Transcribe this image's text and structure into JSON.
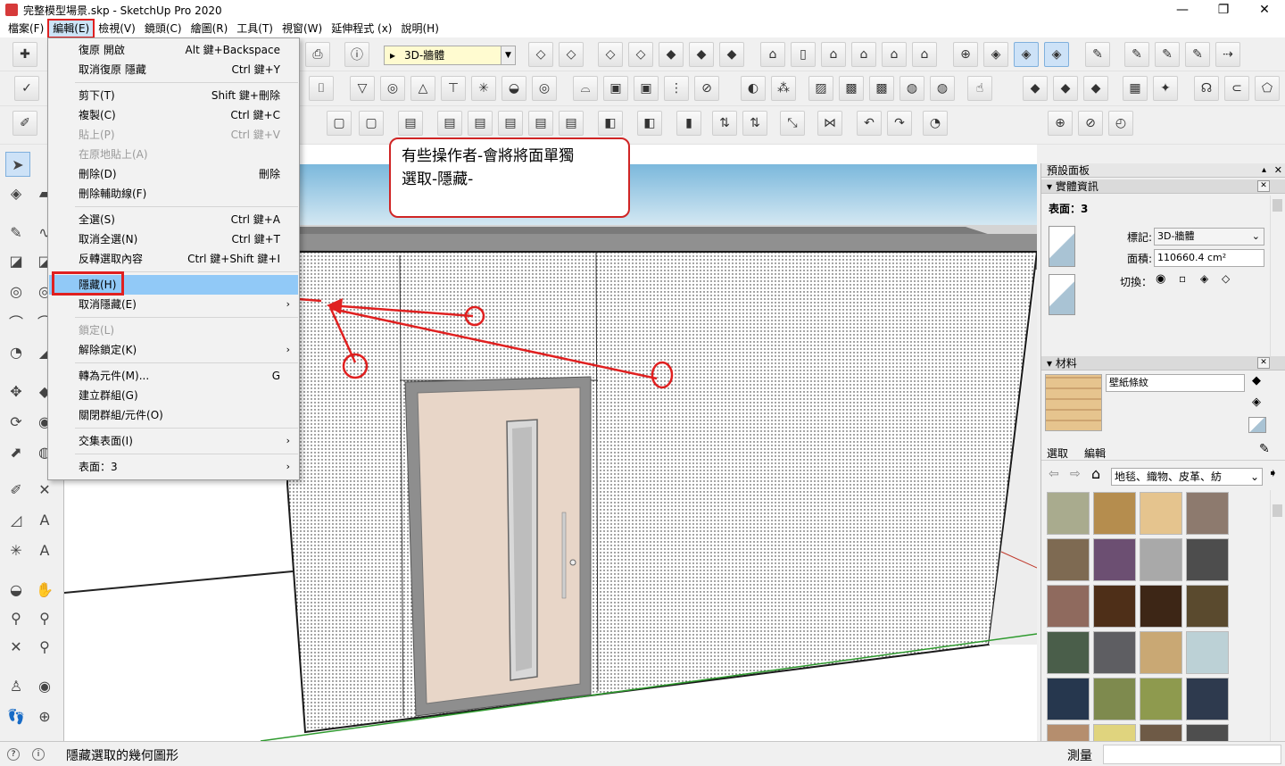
{
  "window": {
    "title": "完整模型場景.skp - SketchUp Pro 2020",
    "minimize": "—",
    "restore": "❐",
    "close": "✕"
  },
  "menubar": {
    "items": [
      "檔案(F)",
      "編輯(E)",
      "檢視(V)",
      "鏡頭(C)",
      "繪圖(R)",
      "工具(T)",
      "視窗(W)",
      "延伸程式 (x)",
      "說明(H)"
    ],
    "active": "編輯(E)"
  },
  "layer_select": {
    "value": "3D-牆體",
    "arrow": "▼",
    "pointer": "▸"
  },
  "edit_menu": {
    "undo": {
      "label": "復原 開啟",
      "shortcut": "Alt 鍵+Backspace"
    },
    "redo": {
      "label": "取消復原 隱藏",
      "shortcut": "Ctrl 鍵+Y"
    },
    "cut": {
      "label": "剪下(T)",
      "shortcut": "Shift 鍵+刪除"
    },
    "copy": {
      "label": "複製(C)",
      "shortcut": "Ctrl 鍵+C"
    },
    "paste": {
      "label": "貼上(P)",
      "shortcut": "Ctrl 鍵+V"
    },
    "paste_in_place": {
      "label": "在原地貼上(A)"
    },
    "delete": {
      "label": "刪除(D)",
      "shortcut": "刪除"
    },
    "delete_guides": {
      "label": "刪除輔助線(F)"
    },
    "select_all": {
      "label": "全選(S)",
      "shortcut": "Ctrl 鍵+A"
    },
    "select_none": {
      "label": "取消全選(N)",
      "shortcut": "Ctrl 鍵+T"
    },
    "invert_selection": {
      "label": "反轉選取內容",
      "shortcut": "Ctrl 鍵+Shift 鍵+I"
    },
    "hide": {
      "label": "隱藏(H)"
    },
    "unhide": {
      "label": "取消隱藏(E)"
    },
    "lock": {
      "label": "鎖定(L)"
    },
    "unlock": {
      "label": "解除鎖定(K)"
    },
    "make_component": {
      "label": "轉為元件(M)...",
      "shortcut": "G"
    },
    "make_group": {
      "label": "建立群組(G)"
    },
    "close_group": {
      "label": "關閉群組/元件(O)"
    },
    "intersect_faces": {
      "label": "交集表面(I)"
    },
    "faces": {
      "label": "表面：3"
    },
    "submenu_arrow": "›"
  },
  "callout": {
    "line1": "有些操作者-會將將面單獨",
    "line2": "選取-隱藏-"
  },
  "tray": {
    "title": "預設面板",
    "pin": "▴",
    "close": "✕",
    "entity_info": {
      "header": "實體資訊",
      "summary": "表面：3",
      "tag_label": "標記:",
      "tag_value": "3D-牆體",
      "area_label": "面積:",
      "area_value": "110660.4 cm²",
      "toggle_label": "切換："
    },
    "materials": {
      "header": "材料",
      "name_value": "壁紙條紋",
      "tabs": [
        "選取",
        "編輯"
      ],
      "category": "地毯、織物、皮革、紡",
      "tile_colors": [
        "#a9ab8e",
        "#b58d4e",
        "#e5c48e",
        "#8d7a6e",
        "#7e6a52",
        "#6c4f72",
        "#a9a9a9",
        "#4d4d4d",
        "#8f6a5e",
        "#4e2f18",
        "#3d2616",
        "#5a4a2e",
        "#4a5e4a",
        "#5e5e62",
        "#c9a874",
        "#bcd1d6",
        "#26374e",
        "#7e8a4e",
        "#8e9a4e",
        "#2e3a4e",
        "#b58e6e",
        "#e0d47e",
        "#6e5a46",
        "#4e4e4e"
      ]
    }
  },
  "statusbar": {
    "icon1": "?",
    "icon2": "i",
    "text": "隱藏選取的幾何圖形",
    "measure_label": "測量"
  },
  "colors": {
    "accent_red": "#e02020",
    "menu_highlight": "#91c9f7",
    "sky": "#a3cfe8",
    "wall_pattern": "#1a1a1a",
    "door": "#e8d6c8"
  }
}
